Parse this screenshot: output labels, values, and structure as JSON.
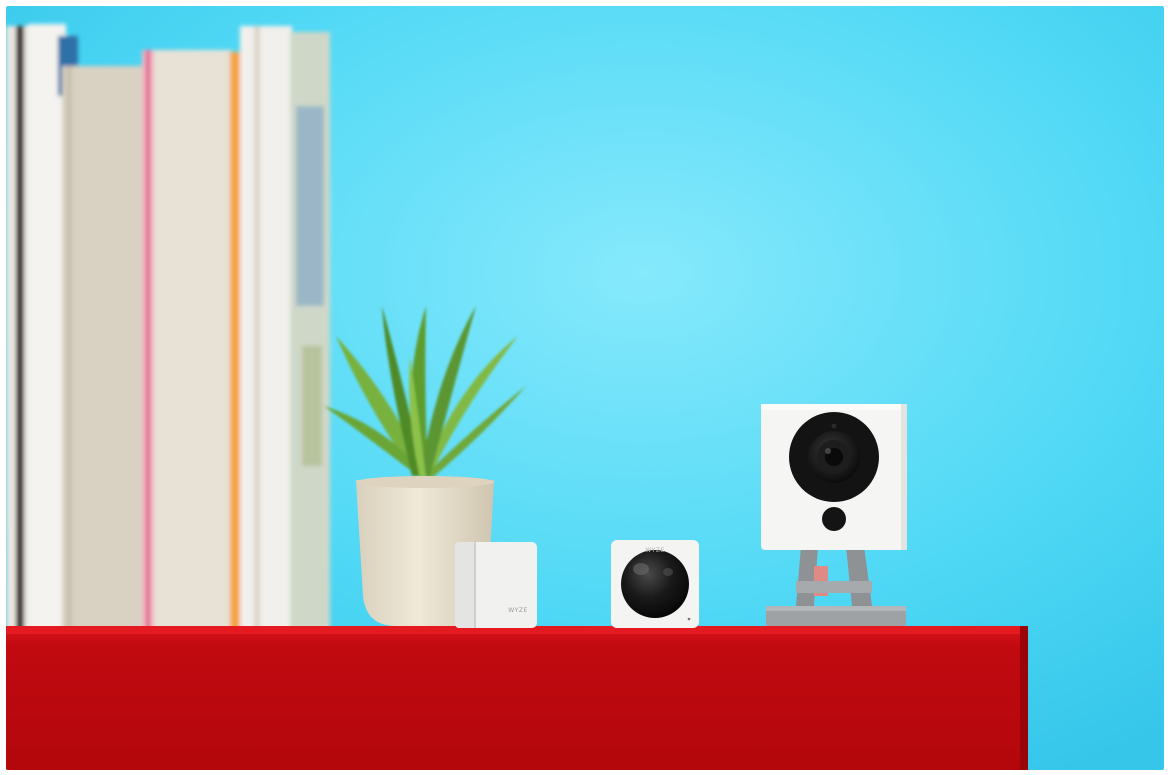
{
  "photo": {
    "colors": {
      "wall": "#49d6f4",
      "wall_glow": "#7fe6fb",
      "shelf": "#c8070c",
      "shelf_top": "#e0141a",
      "device_white": "#f3f3f1",
      "lens_black": "#151515",
      "pot": "#e9e1cf",
      "leaf": "#6ea836",
      "stand": "#9a9ea0"
    },
    "devices": [
      {
        "name": "contact-sensor",
        "brand": "WYZE"
      },
      {
        "name": "motion-sensor",
        "brand": "WYZE"
      },
      {
        "name": "security-camera"
      }
    ]
  }
}
